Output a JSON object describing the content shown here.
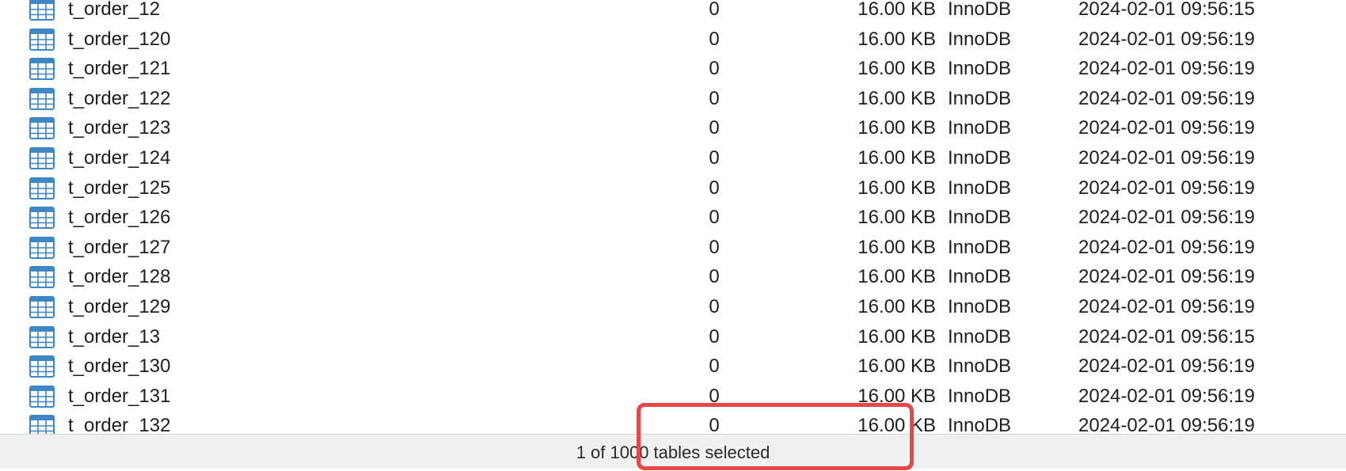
{
  "table": {
    "row_icon": "table-grid-icon",
    "icon_color": "#3f86c4",
    "rows": [
      {
        "name": "t_order_12",
        "rows": "0",
        "size": "16.00 KB",
        "engine": "InnoDB",
        "created": "2024-02-01 09:56:15"
      },
      {
        "name": "t_order_120",
        "rows": "0",
        "size": "16.00 KB",
        "engine": "InnoDB",
        "created": "2024-02-01 09:56:19"
      },
      {
        "name": "t_order_121",
        "rows": "0",
        "size": "16.00 KB",
        "engine": "InnoDB",
        "created": "2024-02-01 09:56:19"
      },
      {
        "name": "t_order_122",
        "rows": "0",
        "size": "16.00 KB",
        "engine": "InnoDB",
        "created": "2024-02-01 09:56:19"
      },
      {
        "name": "t_order_123",
        "rows": "0",
        "size": "16.00 KB",
        "engine": "InnoDB",
        "created": "2024-02-01 09:56:19"
      },
      {
        "name": "t_order_124",
        "rows": "0",
        "size": "16.00 KB",
        "engine": "InnoDB",
        "created": "2024-02-01 09:56:19"
      },
      {
        "name": "t_order_125",
        "rows": "0",
        "size": "16.00 KB",
        "engine": "InnoDB",
        "created": "2024-02-01 09:56:19"
      },
      {
        "name": "t_order_126",
        "rows": "0",
        "size": "16.00 KB",
        "engine": "InnoDB",
        "created": "2024-02-01 09:56:19"
      },
      {
        "name": "t_order_127",
        "rows": "0",
        "size": "16.00 KB",
        "engine": "InnoDB",
        "created": "2024-02-01 09:56:19"
      },
      {
        "name": "t_order_128",
        "rows": "0",
        "size": "16.00 KB",
        "engine": "InnoDB",
        "created": "2024-02-01 09:56:19"
      },
      {
        "name": "t_order_129",
        "rows": "0",
        "size": "16.00 KB",
        "engine": "InnoDB",
        "created": "2024-02-01 09:56:19"
      },
      {
        "name": "t_order_13",
        "rows": "0",
        "size": "16.00 KB",
        "engine": "InnoDB",
        "created": "2024-02-01 09:56:15"
      },
      {
        "name": "t_order_130",
        "rows": "0",
        "size": "16.00 KB",
        "engine": "InnoDB",
        "created": "2024-02-01 09:56:19"
      },
      {
        "name": "t_order_131",
        "rows": "0",
        "size": "16.00 KB",
        "engine": "InnoDB",
        "created": "2024-02-01 09:56:19"
      },
      {
        "name": "t_order_132",
        "rows": "0",
        "size": "16.00 KB",
        "engine": "InnoDB",
        "created": "2024-02-01 09:56:19"
      }
    ]
  },
  "status_bar": {
    "selection_text": "1 of 1000 tables selected"
  },
  "highlight": {
    "color": "#e8474a"
  }
}
